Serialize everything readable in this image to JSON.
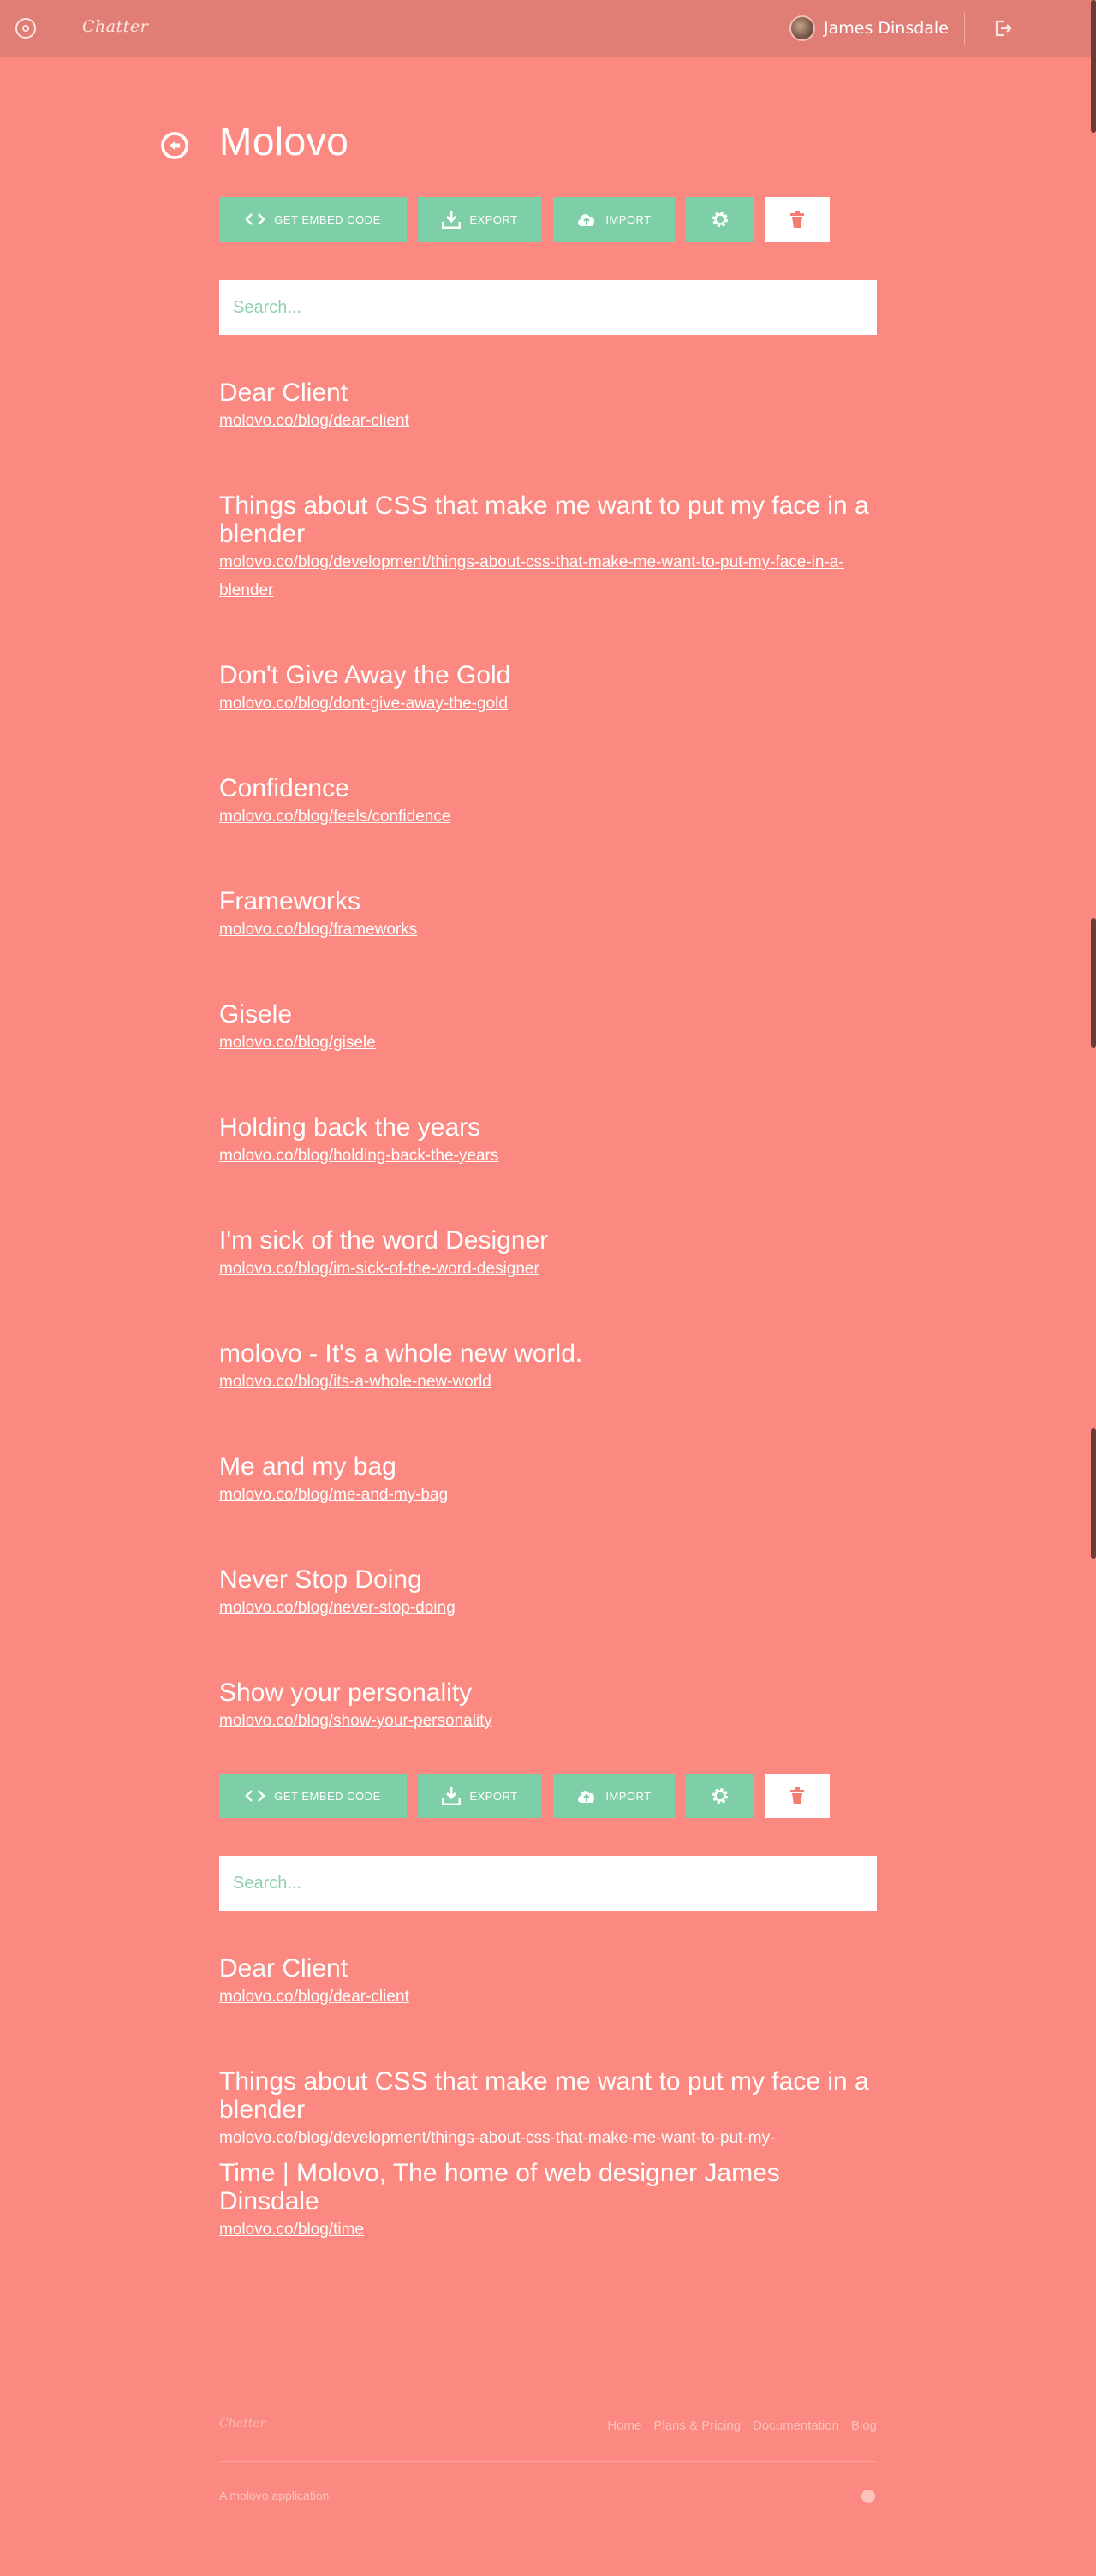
{
  "header": {
    "brand": "Chatter",
    "user_name": "James Dinsdale"
  },
  "page": {
    "title": "Molovo"
  },
  "toolbar": {
    "embed_label": "GET EMBED CODE",
    "export_label": "EXPORT",
    "import_label": "IMPORT"
  },
  "search": {
    "placeholder": "Search..."
  },
  "posts": [
    {
      "title": "Dear Client",
      "link": "molovo.co/blog/dear-client"
    },
    {
      "title": "Things about CSS that make me want to put my face in a blender",
      "link": "molovo.co/blog/development/things-about-css-that-make-me-want-to-put-my-face-in-a-blender"
    },
    {
      "title": "Don't Give Away the Gold",
      "link": "molovo.co/blog/dont-give-away-the-gold"
    },
    {
      "title": "Confidence",
      "link": "molovo.co/blog/feels/confidence"
    },
    {
      "title": "Frameworks",
      "link": "molovo.co/blog/frameworks"
    },
    {
      "title": "Gisele",
      "link": "molovo.co/blog/gisele"
    },
    {
      "title": "Holding back the years",
      "link": "molovo.co/blog/holding-back-the-years"
    },
    {
      "title": "I'm sick of the word Designer",
      "link": "molovo.co/blog/im-sick-of-the-word-designer"
    },
    {
      "title": "molovo - It's a whole new world.",
      "link": "molovo.co/blog/its-a-whole-new-world"
    },
    {
      "title": "Me and my bag",
      "link": "molovo.co/blog/me-and-my-bag"
    },
    {
      "title": "Never Stop Doing",
      "link": "molovo.co/blog/never-stop-doing"
    },
    {
      "title": "Show your personality",
      "link": "molovo.co/blog/show-your-personality"
    }
  ],
  "posts_second": [
    {
      "title": "Dear Client",
      "link": "molovo.co/blog/dear-client"
    },
    {
      "title": "Things about CSS that make me want to put my face in a blender",
      "link": "molovo.co/blog/development/things-about-css-that-make-me-want-to-put-my-"
    },
    {
      "title": "Time | Molovo, The home of web designer James Dinsdale",
      "link": "molovo.co/blog/time"
    }
  ],
  "footer": {
    "brand": "Chatter",
    "links": [
      "Home",
      "Plans & Pricing",
      "Documentation",
      "Blog"
    ],
    "credit": "A molovo application."
  },
  "colors": {
    "background": "#fb8981",
    "topbar": "#e07e76",
    "accent": "#7ecfa7",
    "delete_icon": "#f47c73"
  }
}
